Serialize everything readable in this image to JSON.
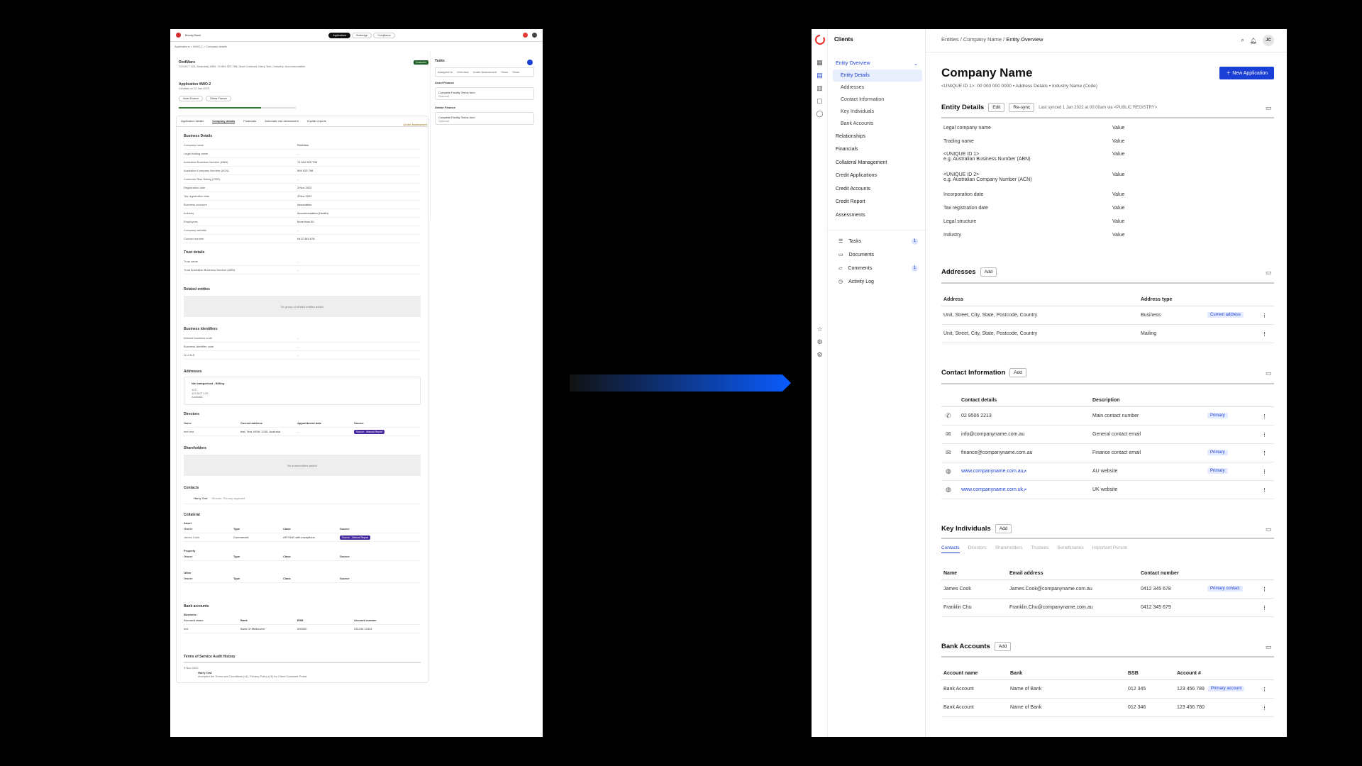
{
  "left": {
    "brand": "Moody Bank",
    "pills": [
      "Applications",
      "Brokerage",
      "Compliance"
    ],
    "breadcrumb": "Applications > #MIO-2 > Company details",
    "company": "RedMars",
    "company_meta": "123 ACT 123, Australia | ABN: 74 594 923 798 | Next Contract: Harry Test | Industry: Accommodation",
    "status": "Customer",
    "application": "Application #MIO-2",
    "application_meta": "Created on 12 Jan 2023",
    "chips": [
      "Asset Finance",
      "Debtor Finance"
    ],
    "stage": "Under Assessment",
    "tabs": [
      "Application details",
      "Company details",
      "Financials",
      "Automatic risk assessment",
      "Equifax reports"
    ],
    "business_details": {
      "title": "Business Details",
      "rows": [
        [
          "Company name",
          "RedMars"
        ],
        [
          "Legal trading name",
          "-"
        ],
        [
          "Australian Business Number (ABN)",
          "74 594 923 798"
        ],
        [
          "Australian Company Number (ACN)",
          "594 923 798"
        ],
        [
          "Customer Risk Rating (CRR)",
          "-"
        ],
        [
          "Registration date",
          "3 Nov 2022"
        ],
        [
          "Tax registration date",
          "3 Nov 2022"
        ],
        [
          "Business structure",
          "Association"
        ],
        [
          "Industry",
          "Accommodation (Health)"
        ],
        [
          "Employees",
          "More than 50"
        ],
        [
          "Company website",
          "-"
        ],
        [
          "Contact number",
          "0412 345 678"
        ]
      ],
      "trust_title": "Trust details",
      "trust_rows": [
        [
          "Trust name",
          "-"
        ],
        [
          "Trust Australian Business Number (ABN)",
          "-"
        ]
      ]
    },
    "related": {
      "title": "Related entities",
      "empty": "No group of related entities added"
    },
    "identifiers": {
      "title": "Business identifiers",
      "rows": [
        [
          "Internal business code",
          "-"
        ],
        [
          "Business identifier code",
          "-"
        ],
        [
          "D-U-N-S",
          "-"
        ]
      ]
    },
    "addresses": {
      "title": "Addresses",
      "card_title": "Not categorised - Billing",
      "lines": [
        "123",
        "123 ACT 123",
        "Australia"
      ]
    },
    "directors": {
      "title": "Directors",
      "cols": [
        "Name",
        "Current address",
        "Appointment date",
        "Source"
      ],
      "row": [
        "test test",
        "test, Test, NSW, 2155, Australia",
        "-",
        "Source - Manual Report"
      ]
    },
    "shareholders": {
      "title": "Shareholders",
      "empty": "No shareholders added"
    },
    "contacts": {
      "title": "Contacts",
      "name": "Harry Test",
      "role": "Director, Primary applicant"
    },
    "collateral": {
      "title": "Collateral",
      "asset": "Asset",
      "cols": [
        "Owner",
        "Type",
        "Class",
        "Source"
      ],
      "row": [
        "James Cook",
        "Commercial",
        "AFFIXAY with exceptions",
        "Source - Manual Report"
      ],
      "property": "Property",
      "other": "Other"
    },
    "bank": {
      "title": "Bank accounts",
      "sub": "Business",
      "cols": [
        "Account name",
        "Bank",
        "BSB",
        "Account number"
      ],
      "row": [
        "test",
        "Bank Of Melbourne",
        "000000",
        "231234 12344"
      ]
    },
    "terms": {
      "title": "Terms of Service Audit History",
      "date": "3 Nov 2022",
      "who": "Harry Test",
      "text": "Accepted the Terms and Conditions (v1), Privacy Policy (v1) for Client Customer Portal"
    },
    "tasks": {
      "title": "Tasks",
      "filters": [
        "Assigned to",
        "Overview",
        "Under Assessment",
        "Show",
        "Show"
      ],
      "groups": [
        "Asset Finance",
        "Debtor Finance"
      ],
      "item": "Complete Facility Terms form",
      "item_sub": "Optional"
    }
  },
  "sidebar": {
    "app_title": "Clients",
    "entity_overview": "Entity Overview",
    "sub_items": [
      "Entity Details",
      "Addresses",
      "Contact Information",
      "Key Individuals",
      "Bank Accounts"
    ],
    "items": [
      "Relationships",
      "Financials",
      "Collateral Management",
      "Credit Applications",
      "Credit Accounts",
      "Credit Report",
      "Assessments"
    ],
    "utility": [
      {
        "label": "Tasks",
        "count": "1"
      },
      {
        "label": "Documents",
        "count": ""
      },
      {
        "label": "Comments",
        "count": "1"
      },
      {
        "label": "Activity Log",
        "count": ""
      }
    ]
  },
  "header": {
    "breadcrumb": [
      "Entities",
      "Company Name",
      "Entity Overview"
    ],
    "avatar": "JC"
  },
  "page": {
    "title": "Company Name",
    "subtitle": "<UNIQUE ID 1>: 00 000 000 0000 • Address Details • Industry Name (Code)",
    "new_button": "New Application"
  },
  "entity_details": {
    "title": "Entity Details",
    "edit": "Edit",
    "resync": "Re-sync",
    "sync_note": "Last synced 1 Jan 2022 at 00:00am via <PUBLIC REGISTRY>",
    "rows": [
      {
        "label": "Legal company name",
        "sub": "",
        "value": "Value"
      },
      {
        "label": "Trading name",
        "sub": "",
        "value": "Value"
      },
      {
        "label": "<UNIQUE ID 1>",
        "sub": "e.g. Australian Business Number (ABN)",
        "value": "Value"
      },
      {
        "label": "<UNIQUE ID 2>",
        "sub": "e.g. Australian Company Number (ACN)",
        "value": "Value"
      },
      {
        "label": "Incorporation date",
        "sub": "",
        "value": "Value"
      },
      {
        "label": "Tax registration date",
        "sub": "",
        "value": "Value"
      },
      {
        "label": "Legal structure",
        "sub": "",
        "value": "Value"
      },
      {
        "label": "Industry",
        "sub": "",
        "value": "Value"
      }
    ]
  },
  "addresses": {
    "title": "Addresses",
    "add": "Add",
    "cols": [
      "Address",
      "Address type"
    ],
    "rows": [
      {
        "address": "Unit, Street, City, State, Postcode, Country",
        "type": "Business",
        "tag": "Current address"
      },
      {
        "address": "Unit, Street, City, State, Postcode, Country",
        "type": "Mailing",
        "tag": ""
      }
    ]
  },
  "contact_info": {
    "title": "Contact Information",
    "add": "Add",
    "cols": [
      "Contact details",
      "Description"
    ],
    "rows": [
      {
        "icon": "phone-icon",
        "value": "02 9506 2213",
        "desc": "Main contact number",
        "tag": "Primary",
        "link": false
      },
      {
        "icon": "mail-icon",
        "value": "info@companyname.com.au",
        "desc": "General contact email",
        "tag": "",
        "link": false
      },
      {
        "icon": "mail-icon",
        "value": "finance@companyname.com.au",
        "desc": "Finance contact email",
        "tag": "Primary",
        "link": false
      },
      {
        "icon": "globe-icon",
        "value": "www.companyname.com.au",
        "desc": "AU website",
        "tag": "Primary",
        "link": true
      },
      {
        "icon": "globe-icon",
        "value": "www.companyname.com.uk",
        "desc": "UK website",
        "tag": "",
        "link": true
      }
    ]
  },
  "key_individuals": {
    "title": "Key Individuals",
    "add": "Add",
    "tabs": [
      "Contacts",
      "Directors",
      "Shareholders",
      "Trustees",
      "Beneficiaries",
      "Important Person"
    ],
    "cols": [
      "Name",
      "Email address",
      "Contact number"
    ],
    "rows": [
      {
        "name": "James Cook",
        "email": "James.Cook@companyname.com.au",
        "phone": "0412 345 678",
        "tag": "Primary contact"
      },
      {
        "name": "Franklin Chu",
        "email": "Franklin.Chu@companyname.com.au",
        "phone": "0412 345 679",
        "tag": ""
      }
    ]
  },
  "bank_accounts": {
    "title": "Bank Accounts",
    "add": "Add",
    "cols": [
      "Account name",
      "Bank",
      "BSB",
      "Account #"
    ],
    "rows": [
      {
        "name": "Bank Account",
        "bank": "Name of Bank",
        "bsb": "012 345",
        "acct": "123 456 789",
        "tag": "Primary account"
      },
      {
        "name": "Bank Account",
        "bank": "Name of Bank",
        "bsb": "012 346",
        "acct": "123 456 780",
        "tag": ""
      }
    ]
  },
  "colors": {
    "accent": "#1a3fd6",
    "pill_bg": "#e4eaff",
    "brand_red": "#e53935"
  }
}
